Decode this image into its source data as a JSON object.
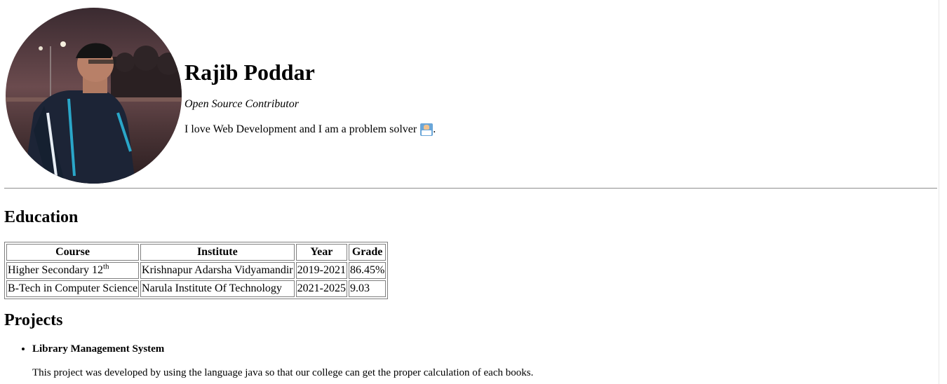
{
  "profile": {
    "name": "Rajib Poddar",
    "tagline": "Open Source Contributor",
    "bio": "I love Web Development and I am a problem solver",
    "bio_end": ".",
    "emoji_icon": "technologist-emoji-icon"
  },
  "education": {
    "title": "Education",
    "headers": [
      "Course",
      "Institute",
      "Year",
      "Grade"
    ],
    "rows": [
      {
        "course": "Higher Secondary 12",
        "course_sup": "th",
        "institute": "Krishnapur Adarsha Vidyamandir",
        "year": "2019-2021",
        "grade": "86.45%"
      },
      {
        "course": "B-Tech in Computer Science",
        "course_sup": "",
        "institute": "Narula Institute Of Technology",
        "year": "2021-2025",
        "grade": "9.03"
      }
    ]
  },
  "projects": {
    "title": "Projects",
    "items": [
      {
        "name": "Library Management System",
        "description": "This project was developed by using the language java so that our college can get the proper calculation of each books."
      }
    ]
  }
}
